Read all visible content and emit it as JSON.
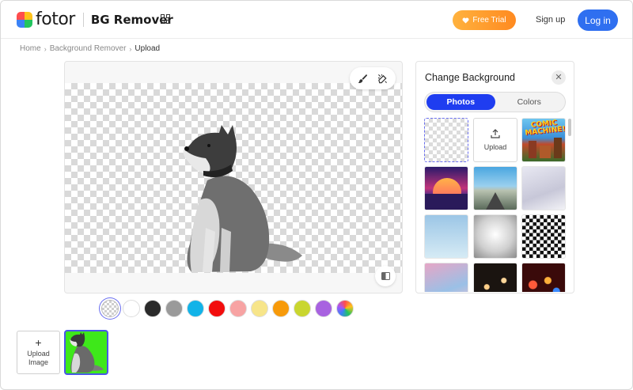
{
  "header": {
    "brand": "fotor",
    "product": "BG Remover",
    "free_trial": "Free Trial",
    "sign_up": "Sign up",
    "log_in": "Log in"
  },
  "breadcrumb": [
    "Home",
    "Background Remover",
    "Upload"
  ],
  "canvas": {
    "tools": [
      "brush-icon",
      "eraser-icon"
    ],
    "compare": "compare-icon"
  },
  "swatches": [
    {
      "name": "transparent",
      "color": "transparent"
    },
    {
      "name": "white",
      "color": "#ffffff"
    },
    {
      "name": "black",
      "color": "#2b2b2b"
    },
    {
      "name": "gray",
      "color": "#9a9a9a"
    },
    {
      "name": "blue",
      "color": "#12b3e8"
    },
    {
      "name": "red",
      "color": "#f20d0d"
    },
    {
      "name": "pink",
      "color": "#f7a3a3"
    },
    {
      "name": "light-yellow",
      "color": "#f7e58a"
    },
    {
      "name": "orange",
      "color": "#f79a0a"
    },
    {
      "name": "lime",
      "color": "#c9d62f"
    },
    {
      "name": "purple",
      "color": "#a862e0"
    },
    {
      "name": "gradient",
      "color": "conic"
    }
  ],
  "change_background": {
    "title": "Change Background",
    "tabs": [
      "Photos",
      "Colors"
    ],
    "active_tab": "Photos",
    "upload_label": "Upload",
    "tiles": [
      "transparent",
      "upload",
      "comic-machine",
      "synthwave-sun",
      "desert-road",
      "white-studio",
      "sky-gradient",
      "gray-radial",
      "checker-warp",
      "pastel-clouds",
      "dark-bokeh",
      "city-bokeh"
    ],
    "comic_text": "COMIC MACHINE!!"
  },
  "upload_image_label": "Upload Image",
  "colors": {
    "primary": "#2f6ff0",
    "active_tab": "#1f3df0",
    "trial_start": "#ffb23e",
    "trial_end": "#ff8a20",
    "thumb_bg": "#3ee81a"
  }
}
